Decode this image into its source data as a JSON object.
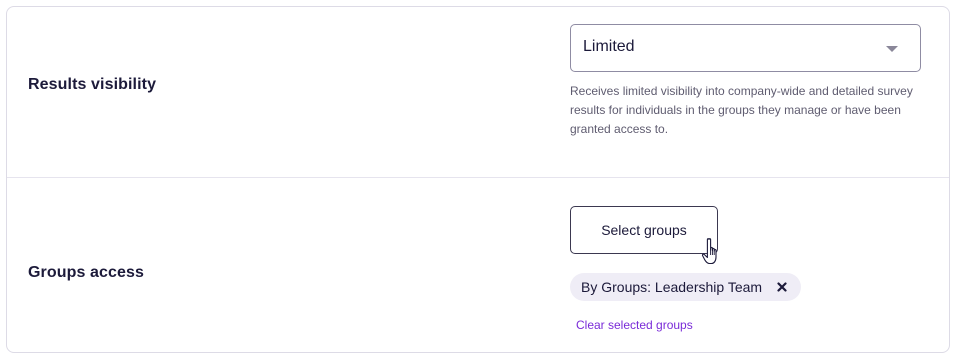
{
  "results_visibility": {
    "label": "Results visibility",
    "select_value": "Limited",
    "description": "Receives limited visibility into company-wide and detailed survey results for individuals in the groups they manage or have been granted access to."
  },
  "groups_access": {
    "label": "Groups access",
    "button_label": "Select groups",
    "chips": [
      {
        "label": "By Groups: Leadership Team"
      }
    ],
    "clear_link": "Clear selected groups"
  },
  "colors": {
    "accent_link": "#7a2bd8",
    "chip_background": "#efedf6",
    "text_primary": "#1c1a3a"
  },
  "icons": {
    "select_caret": "chevron-down-icon",
    "chip_remove": "close-icon",
    "cursor": "hand-pointer-cursor-icon"
  }
}
